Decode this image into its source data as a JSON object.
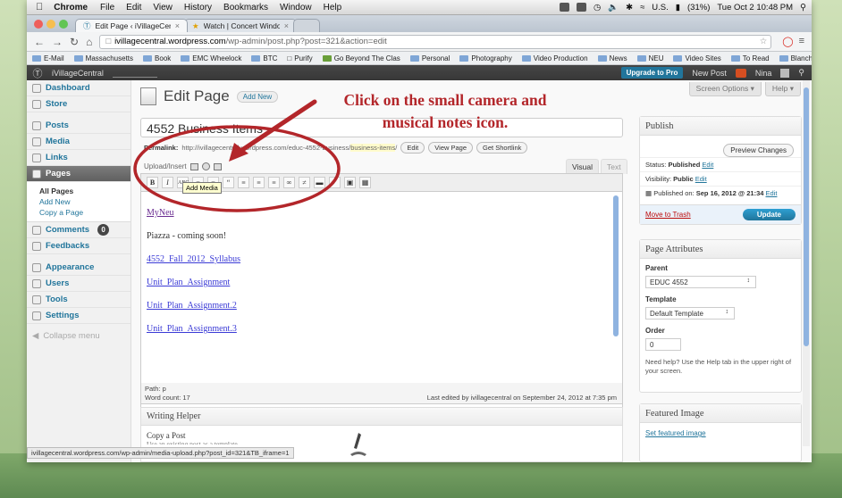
{
  "menubar": {
    "app": "Chrome",
    "items": [
      "File",
      "Edit",
      "View",
      "History",
      "Bookmarks",
      "Window",
      "Help"
    ],
    "input": "U.S.",
    "battery": "(31%)",
    "clock": "Tue Oct 2  10:48 PM"
  },
  "tabs": [
    {
      "label": "Edit Page ‹ iVillageCentral —",
      "active": true
    },
    {
      "label": "Watch | Concert Window",
      "active": false
    }
  ],
  "address": {
    "host": "ivillagecentral.wordpress.com",
    "path": "/wp-admin/post.php?post=321&action=edit"
  },
  "bookmarks": [
    "E-Mail",
    "Massachusetts",
    "Book",
    "EMC Wheelock",
    "BTC",
    "Purify",
    "Go Beyond The Clas",
    "Personal",
    "Photography",
    "Video Production",
    "News",
    "NEU",
    "Video Sites",
    "To Read",
    "Blanchard",
    "»"
  ],
  "adminbar": {
    "site": "iVillageCentral",
    "upgrade": "Upgrade to Pro",
    "new_post": "New Post",
    "user": "Nina"
  },
  "sidebar": {
    "dashboard": "Dashboard",
    "store": "Store",
    "posts": "Posts",
    "media": "Media",
    "links": "Links",
    "pages": "Pages",
    "sub": [
      "All Pages",
      "Add New",
      "Copy a Page"
    ],
    "comments": "Comments",
    "comments_count": "0",
    "feedbacks": "Feedbacks",
    "appearance": "Appearance",
    "users": "Users",
    "tools": "Tools",
    "settings": "Settings",
    "collapse": "Collapse menu"
  },
  "page": {
    "heading": "Edit Page",
    "add_new": "Add New",
    "screen_options": "Screen Options ▾",
    "help": "Help ▾",
    "title_value": "4552 Business Items",
    "permalink_label": "Permalink:",
    "permalink_base": "http://ivillagecentral.wordpress.com/educ-4552-business/",
    "permalink_slug": "business-items",
    "permalink_end": "/",
    "edit": "Edit",
    "view_page": "View Page",
    "get_shortlink": "Get Shortlink",
    "upload_insert": "Upload/Insert",
    "tab_visual": "Visual",
    "tab_text": "Text",
    "tooltip": "Add Media",
    "path": "Path: p",
    "word_count": "Word count: 17",
    "last_edited": "Last edited by ivillagecentral on September 24, 2012 at 7:35 pm"
  },
  "content": {
    "items": [
      {
        "text": "MyNeu",
        "type": "visited"
      },
      {
        "text": "Piazza - coming soon!",
        "type": "text"
      },
      {
        "text": "4552_Fall_2012_Syllabus",
        "type": "link"
      },
      {
        "text": "Unit_Plan_Assignment",
        "type": "link"
      },
      {
        "text": "Unit_Plan_Assignment.2",
        "type": "link"
      },
      {
        "text": "Unit_Plan_Assignment.3",
        "type": "link"
      }
    ]
  },
  "writing": {
    "title": "Writing Helper",
    "copy": "Copy a Post",
    "copy_sub": "Use an existing post as a template."
  },
  "publish": {
    "title": "Publish",
    "preview": "Preview Changes",
    "status_label": "Status:",
    "status_value": "Published",
    "visibility_label": "Visibility:",
    "visibility_value": "Public",
    "published_on_label": "Published on:",
    "published_on": "Sep 16, 2012 @ 21:34",
    "edit": "Edit",
    "trash": "Move to Trash",
    "update": "Update"
  },
  "attributes": {
    "title": "Page Attributes",
    "parent_label": "Parent",
    "parent_value": "EDUC 4552",
    "template_label": "Template",
    "template_value": "Default Template",
    "order_label": "Order",
    "order_value": "0",
    "help": "Need help? Use the Help tab in the upper right of your screen."
  },
  "featured": {
    "title": "Featured Image",
    "link": "Set featured image"
  },
  "annotation": {
    "line1": "Click on the small camera and",
    "line2": "musical notes icon.",
    "color": "#b3262a"
  },
  "statusbar": "ivillagecentral.wordpress.com/wp-admin/media-upload.php?post_id=321&TB_iframe=1"
}
